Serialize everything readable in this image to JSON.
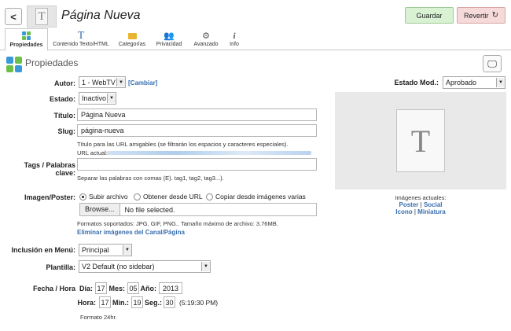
{
  "header": {
    "back_glyph": "<",
    "title": "Página Nueva",
    "save_label": "Guardar",
    "revert_label": "Revertir"
  },
  "tabs": [
    {
      "label": "Propiedades",
      "icon": "properties-icon",
      "active": true
    },
    {
      "label": "Contenido Texto/HTML",
      "icon": "text-icon",
      "active": false
    },
    {
      "label": "Categorías",
      "icon": "folder-icon",
      "active": false
    },
    {
      "label": "Privacidad",
      "icon": "users-icon",
      "active": false
    },
    {
      "label": "Avanzado",
      "icon": "gear-icon",
      "active": false
    },
    {
      "label": "Info",
      "icon": "info-icon",
      "active": false
    }
  ],
  "section": {
    "title": "Propiedades"
  },
  "form": {
    "autor_label": "Autor:",
    "autor_value": "1 - WebTV",
    "autor_change": "[Cambiar]",
    "estado_label": "Estado:",
    "estado_value": "Inactivo",
    "titulo_label": "Título:",
    "titulo_value": "Página Nueva",
    "slug_label": "Slug:",
    "slug_value": "página-nueva",
    "slug_help": "Título para las URL amigables (se filtrarán los espacios y caracteres especiales).",
    "url_label": "URL actual:",
    "tags_label": "Tags / Palabras clave:",
    "tags_value": "",
    "tags_help": "Separar las palabras con comas (E). tag1, tag2, tag3...).",
    "image_label": "Imagen/Poster:",
    "radio_upload": "Subir archivo",
    "radio_url": "Obtener desde URL",
    "radio_copy": "Copiar desde imágenes varias",
    "browse_label": "Browse...",
    "file_status": "No file selected.",
    "formats_help": "Formatos soportados: JPG, GIF, PNG.. Tamaño máximo de archivo: 3.76MB.",
    "delete_link": "Eliminar imágenes del Canal/Página",
    "menu_label": "Inclusión en Menú:",
    "menu_value": "Principal",
    "template_label": "Plantilla:",
    "template_value": "V2 Default (no sidebar)",
    "date_label": "Fecha / Hora",
    "day_label": "Día:",
    "day_value": "17",
    "month_label": "Mes:",
    "month_value": "05",
    "year_label": "Año:",
    "year_value": "2013",
    "hour_label": "Hora:",
    "hour_value": "17",
    "min_label": "Min.:",
    "min_value": "19",
    "sec_label": "Seg.:",
    "sec_value": "30",
    "time_display": "(5:19:30 PM)",
    "format_note": "Formato 24hr."
  },
  "side": {
    "estado_mod_label": "Estado Mod.:",
    "estado_mod_value": "Aprobado",
    "images_label": "Imágenes actuales:",
    "link_poster": "Poster",
    "sep1": "|",
    "link_social": "Social",
    "link_icono": "Icono",
    "sep2": "|",
    "link_miniatura": "Miniatura"
  },
  "colors": {
    "save_bg": "#d9f2d4",
    "revert_bg": "#f6dada",
    "link": "#3a6fb0",
    "preview_bg": "#e9e9e9"
  }
}
